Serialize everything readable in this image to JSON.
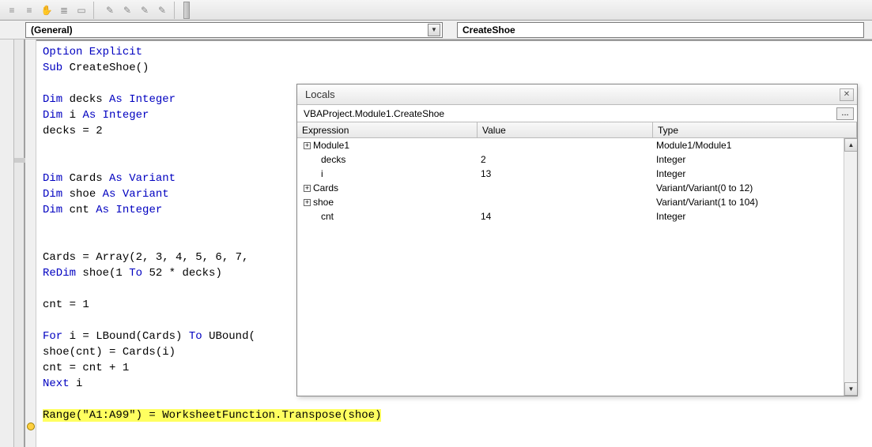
{
  "dropdowns": {
    "object": "(General)",
    "procedure": "CreateShoe"
  },
  "code": {
    "l1_a": "Option Explicit",
    "l2_a": "Sub",
    "l2_b": " CreateShoe()",
    "l3": "",
    "l4_a": "Dim",
    "l4_b": " decks ",
    "l4_c": "As Integer",
    "l5_a": "Dim",
    "l5_b": " i ",
    "l5_c": "As Integer",
    "l6": "decks = 2",
    "l7": "",
    "l8": "",
    "l9_a": "Dim",
    "l9_b": " Cards ",
    "l9_c": "As Variant",
    "l10_a": "Dim",
    "l10_b": " shoe ",
    "l10_c": "As Variant",
    "l11_a": "Dim",
    "l11_b": " cnt ",
    "l11_c": "As Integer",
    "l12": "",
    "l13": "",
    "l14": "Cards = Array(2, 3, 4, 5, 6, 7,",
    "l15_a": "ReDim",
    "l15_b": " shoe(1 ",
    "l15_c": "To",
    "l15_d": " 52 * decks)",
    "l16": "",
    "l17": "cnt = 1",
    "l18": "",
    "l19_a": "For",
    "l19_b": " i = LBound(Cards) ",
    "l19_c": "To",
    "l19_d": " UBound(",
    "l20": "shoe(cnt) = Cards(i)",
    "l21": "cnt = cnt + 1",
    "l22_a": "Next",
    "l22_b": " i",
    "l23": "",
    "l24_a": "Range(\"A1:A99\")",
    "l24_b": " = WorksheetFunction.Transpose(shoe)"
  },
  "locals": {
    "title": "Locals",
    "context": "VBAProject.Module1.CreateShoe",
    "headers": {
      "expression": "Expression",
      "value": "Value",
      "type": "Type"
    },
    "rows": [
      {
        "expr": "Module1",
        "val": "",
        "type": "Module1/Module1",
        "expandable": true
      },
      {
        "expr": "decks",
        "val": "2",
        "type": "Integer",
        "indent": true
      },
      {
        "expr": "i",
        "val": "13",
        "type": "Integer",
        "indent": true
      },
      {
        "expr": "Cards",
        "val": "",
        "type": "Variant/Variant(0 to 12)",
        "expandable": true
      },
      {
        "expr": "shoe",
        "val": "",
        "type": "Variant/Variant(1 to 104)",
        "expandable": true
      },
      {
        "expr": "cnt",
        "val": "14",
        "type": "Integer",
        "indent": true
      }
    ]
  }
}
